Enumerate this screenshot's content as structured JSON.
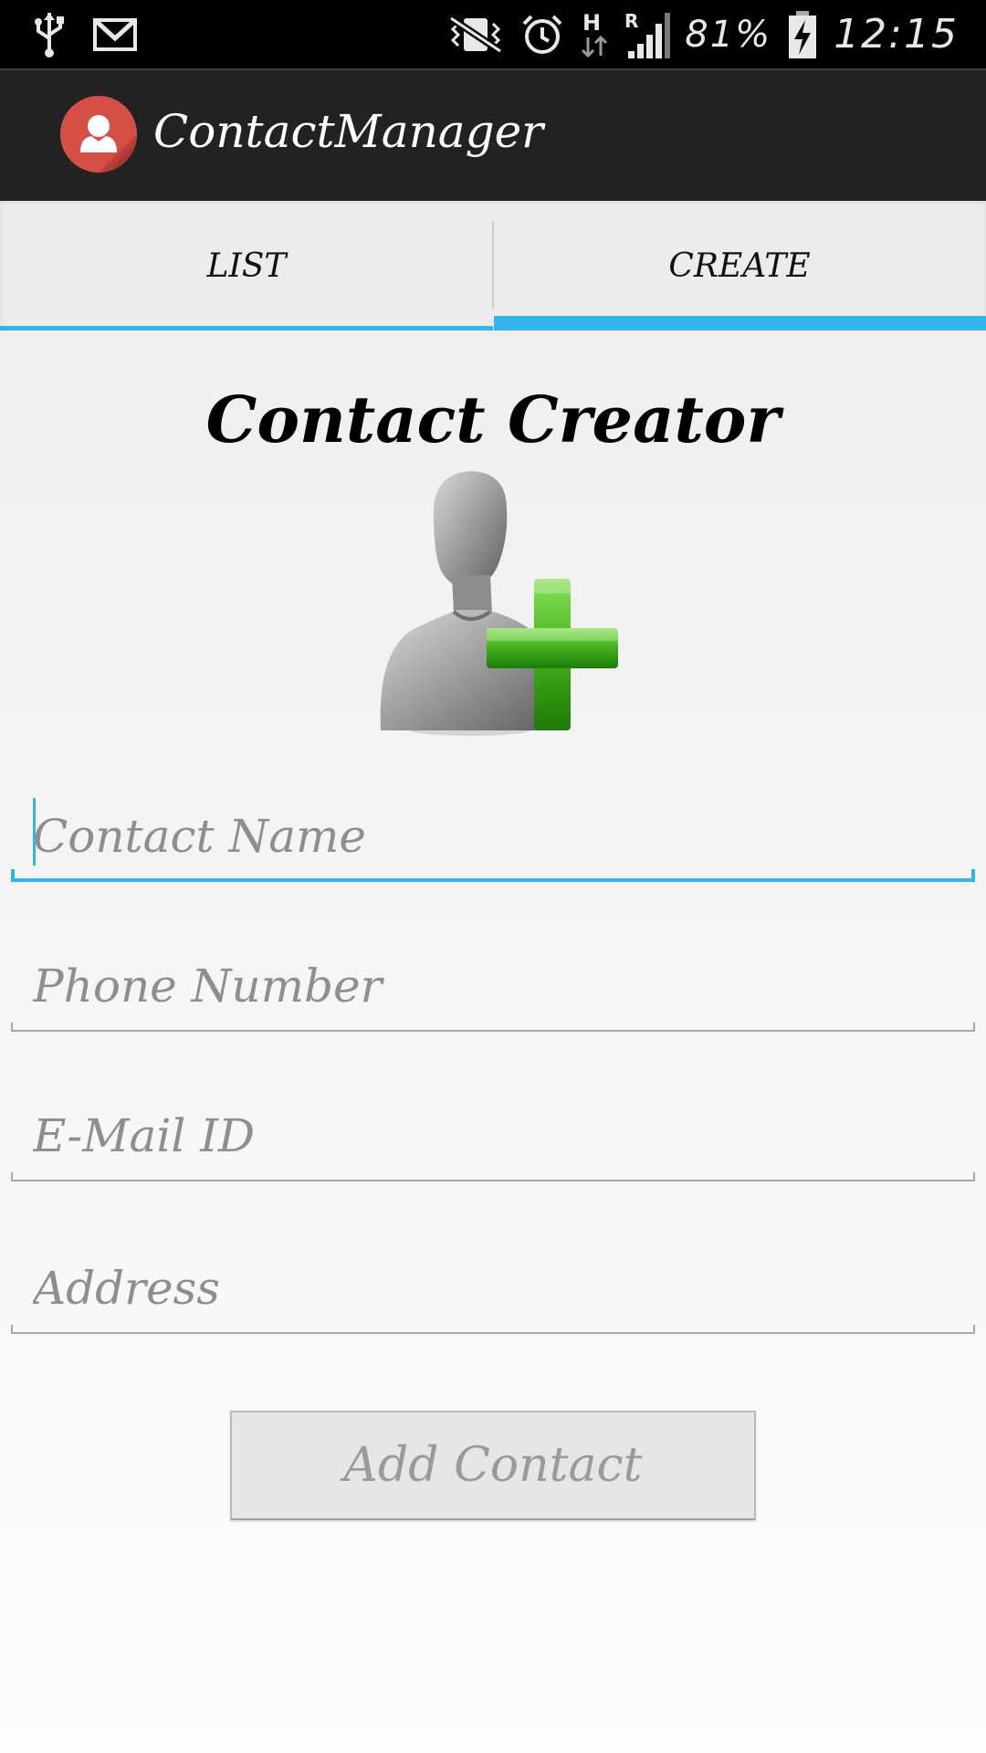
{
  "status_bar": {
    "icons": [
      "usb-icon",
      "gmail-icon",
      "vibrate-icon",
      "alarm-icon",
      "hspa-data-icon",
      "roaming-signal-icon",
      "battery-charging-icon"
    ],
    "network_type": "H",
    "roaming_indicator": "R",
    "battery_percent": "81%",
    "time": "12:15"
  },
  "app_bar": {
    "title": "ContactManager",
    "logo_icon": "contact-avatar-icon",
    "logo_color": "#d64f47"
  },
  "tabs": [
    {
      "label": "LIST",
      "selected": false
    },
    {
      "label": "CREATE",
      "selected": true
    }
  ],
  "accent_color": "#33b5e5",
  "form": {
    "title": "Contact Creator",
    "hero_icon": "add-contact-icon",
    "fields": {
      "contact_name": {
        "placeholder": "Contact Name",
        "value": ""
      },
      "phone_number": {
        "placeholder": "Phone Number",
        "value": ""
      },
      "email": {
        "placeholder": "E-Mail ID",
        "value": ""
      },
      "address": {
        "placeholder": "Address",
        "value": ""
      }
    },
    "submit_label": "Add Contact",
    "submit_enabled": false
  }
}
